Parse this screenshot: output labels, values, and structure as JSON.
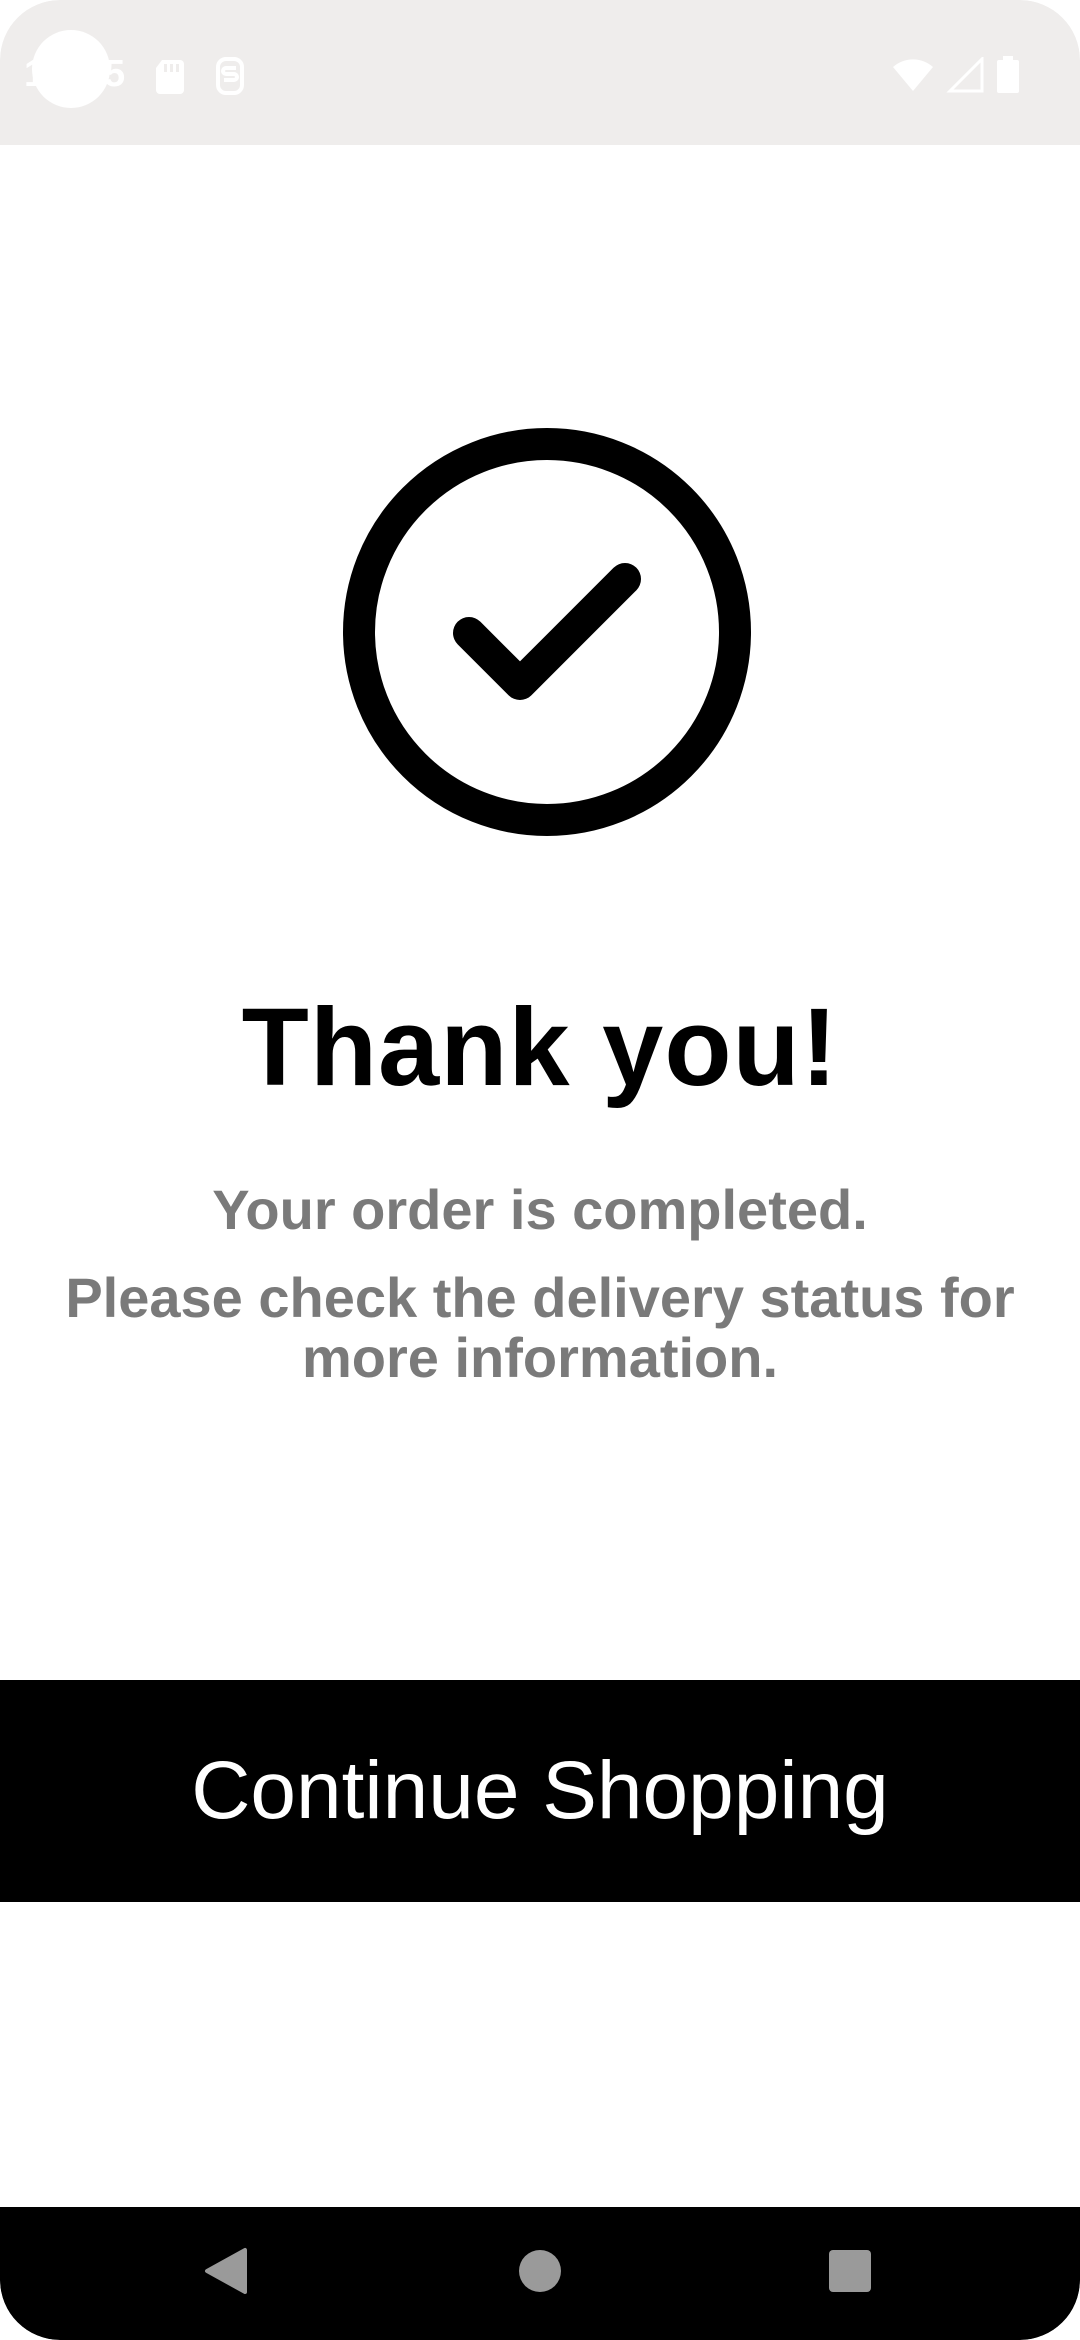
{
  "status_bar": {
    "time": "12:35"
  },
  "confirmation": {
    "icon": "check-circle-icon",
    "title": "Thank you!",
    "line1": "Your order is completed.",
    "line2": "Please check the delivery status for more information."
  },
  "actions": {
    "continue_label": "Continue Shopping"
  },
  "nav": {
    "back": "back-icon",
    "home": "home-icon",
    "recents": "recents-icon"
  },
  "colors": {
    "accent": "#000000",
    "muted_text": "#7a7a7a",
    "status_bar_bg": "#efedec"
  }
}
